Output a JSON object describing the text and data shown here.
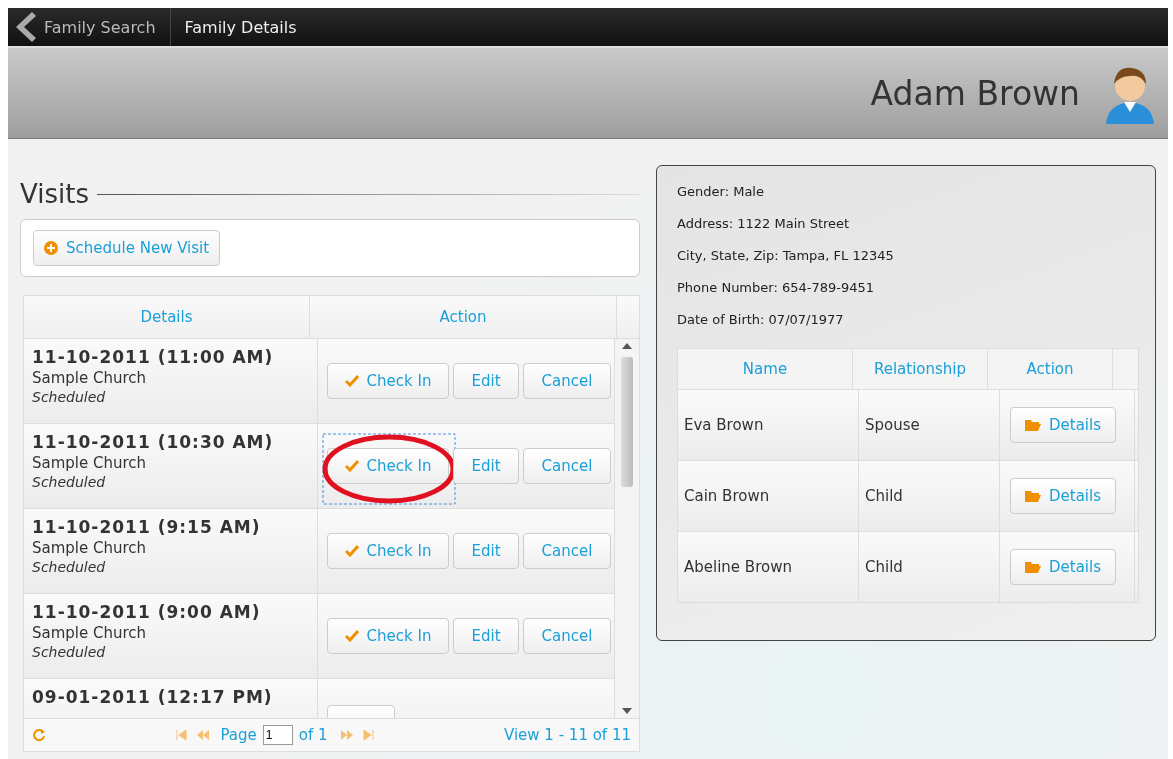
{
  "nav": {
    "back": "Family Search",
    "title": "Family Details"
  },
  "header": {
    "user": "Adam Brown"
  },
  "visits": {
    "title": "Visits",
    "schedule_button": "Schedule New Visit",
    "columns": [
      "Details",
      "Action"
    ],
    "rows": [
      {
        "date": "11-10-2011 (11:00 AM)",
        "place": "Sample Church",
        "status": "Scheduled",
        "actions": [
          {
            "kind": "checkin",
            "label": "Check In",
            "highlighted": false
          },
          {
            "kind": "plain",
            "label": "Edit"
          },
          {
            "kind": "plain",
            "label": "Cancel"
          }
        ]
      },
      {
        "date": "11-10-2011 (10:30 AM)",
        "place": "Sample Church",
        "status": "Scheduled",
        "actions": [
          {
            "kind": "checkin",
            "label": "Check In",
            "highlighted": true
          },
          {
            "kind": "plain",
            "label": "Edit"
          },
          {
            "kind": "plain",
            "label": "Cancel"
          }
        ]
      },
      {
        "date": "11-10-2011 (9:15 AM)",
        "place": "Sample Church",
        "status": "Scheduled",
        "actions": [
          {
            "kind": "checkin",
            "label": "Check In",
            "highlighted": false
          },
          {
            "kind": "plain",
            "label": "Edit"
          },
          {
            "kind": "plain",
            "label": "Cancel"
          }
        ]
      },
      {
        "date": "11-10-2011 (9:00 AM)",
        "place": "Sample Church",
        "status": "Scheduled",
        "actions": [
          {
            "kind": "checkin",
            "label": "Check In",
            "highlighted": false
          },
          {
            "kind": "plain",
            "label": "Edit"
          },
          {
            "kind": "plain",
            "label": "Cancel"
          }
        ]
      },
      {
        "date": "09-01-2011 (12:17 PM)",
        "actions": [
          {
            "kind": "cut"
          }
        ]
      }
    ],
    "pager": {
      "page_label": "Page",
      "page": "1",
      "of": "of 1",
      "view": "View 1 - 11 of 11"
    }
  },
  "family": {
    "info": [
      "Gender: Male",
      "Address: 1122 Main Street",
      "City, State, Zip: Tampa, FL 12345",
      "Phone Number: 654-789-9451",
      "Date of Birth: 07/07/1977"
    ],
    "columns": [
      "Name",
      "Relationship",
      "Action"
    ],
    "members": [
      {
        "name": "Eva Brown",
        "relationship": "Spouse",
        "action": "Details"
      },
      {
        "name": "Cain Brown",
        "relationship": "Child",
        "action": "Details"
      },
      {
        "name": "Abeline Brown",
        "relationship": "Child",
        "action": "Details"
      }
    ]
  }
}
